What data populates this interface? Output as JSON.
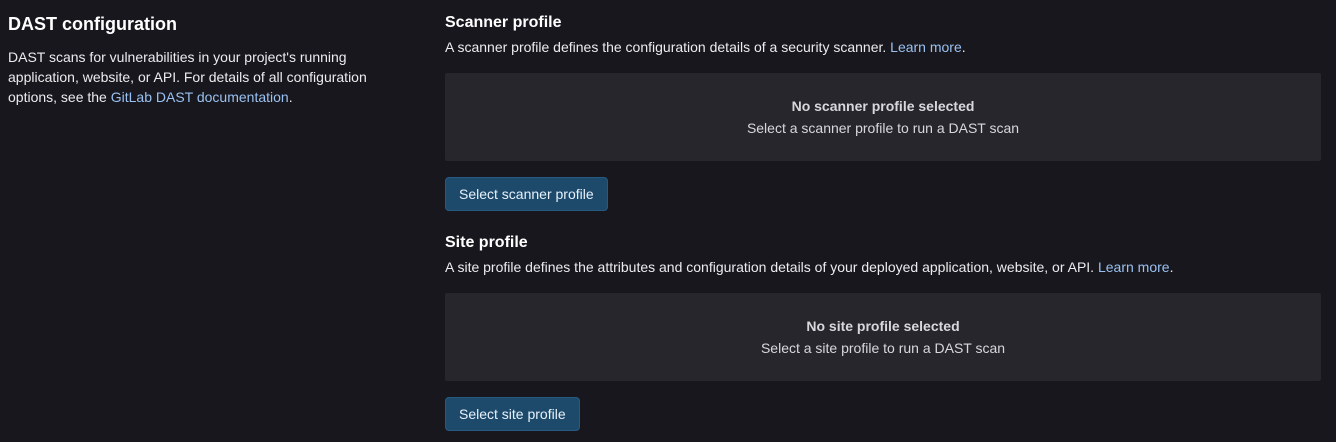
{
  "dast_config": {
    "title": "DAST configuration",
    "description_prefix": "DAST scans for vulnerabilities in your project's running application, website, or API. For details of all configuration options, see the ",
    "doc_link": "GitLab DAST documentation",
    "description_suffix": "."
  },
  "scanner_profile": {
    "title": "Scanner profile",
    "description": "A scanner profile defines the configuration details of a security scanner. ",
    "learn_more": "Learn more",
    "description_suffix": ".",
    "empty_title": "No scanner profile selected",
    "empty_subtitle": "Select a scanner profile to run a DAST scan",
    "button_label": "Select scanner profile"
  },
  "site_profile": {
    "title": "Site profile",
    "description": "A site profile defines the attributes and configuration details of your deployed application, website, or API. ",
    "learn_more": "Learn more",
    "description_suffix": ".",
    "empty_title": "No site profile selected",
    "empty_subtitle": "Select a site profile to run a DAST scan",
    "button_label": "Select site profile"
  },
  "colors": {
    "background": "#18171d",
    "panel": "#27262d",
    "link": "#99c1f1",
    "button": "#1d4a6b"
  }
}
